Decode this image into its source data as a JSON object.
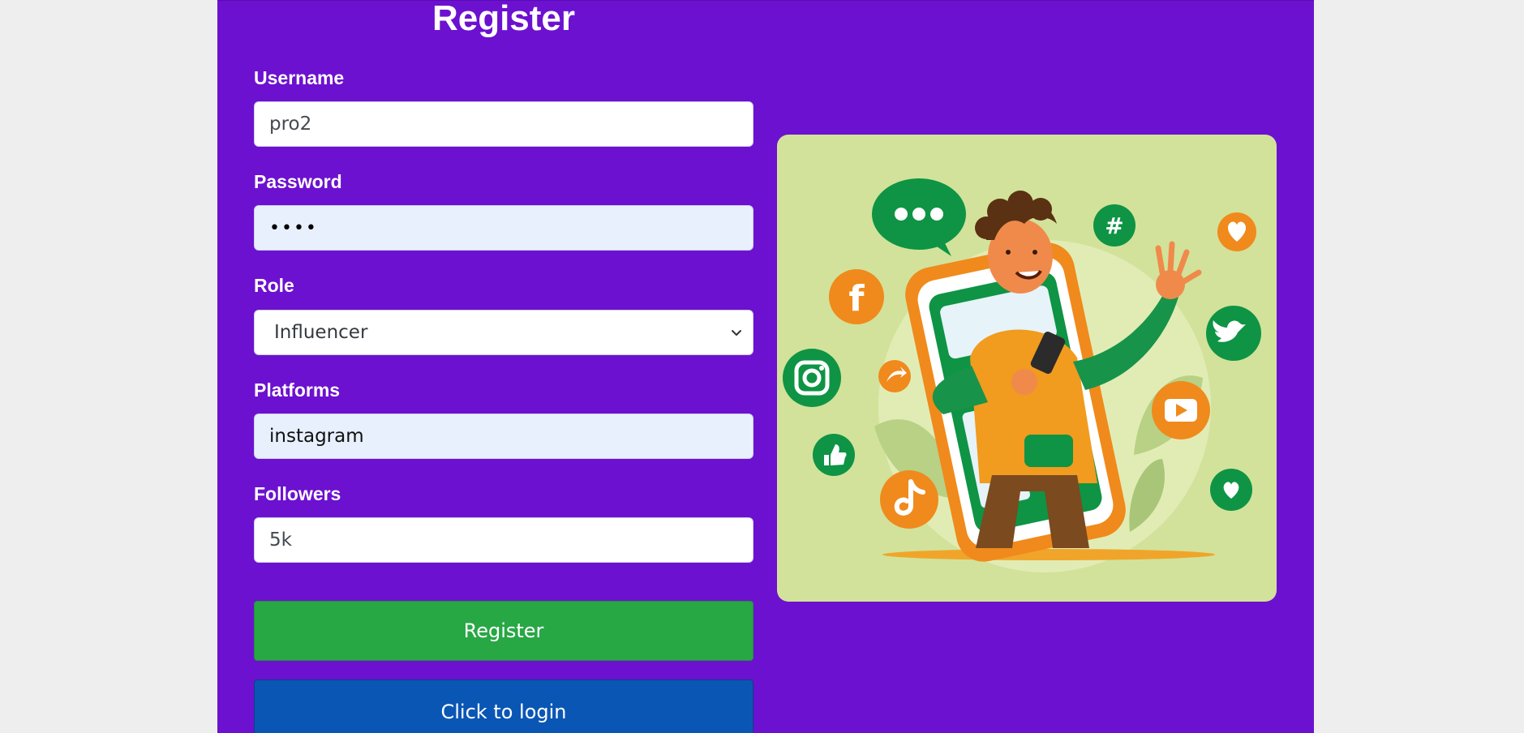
{
  "form": {
    "title": "Register",
    "username": {
      "label": "Username",
      "value": "pro2"
    },
    "password": {
      "label": "Password",
      "value": "••••"
    },
    "role": {
      "label": "Role",
      "value": "Influencer"
    },
    "platforms": {
      "label": "Platforms",
      "value": "instagram"
    },
    "followers": {
      "label": "Followers",
      "value": "5k"
    },
    "register_label": "Register",
    "login_label": "Click to login"
  },
  "colors": {
    "page_background": "#eeeeee",
    "panel_background": "#6c11d0",
    "register_button": "#28a745",
    "login_button": "#0a56b5",
    "illustration_background": "#d2e29a"
  },
  "illustration": {
    "icons": [
      "chat-bubble-icon",
      "facebook-icon",
      "instagram-icon",
      "share-icon",
      "like-icon",
      "tiktok-icon",
      "hashtag-icon",
      "heart-icon",
      "twitter-icon",
      "youtube-icon",
      "heart-bubble-icon"
    ]
  }
}
